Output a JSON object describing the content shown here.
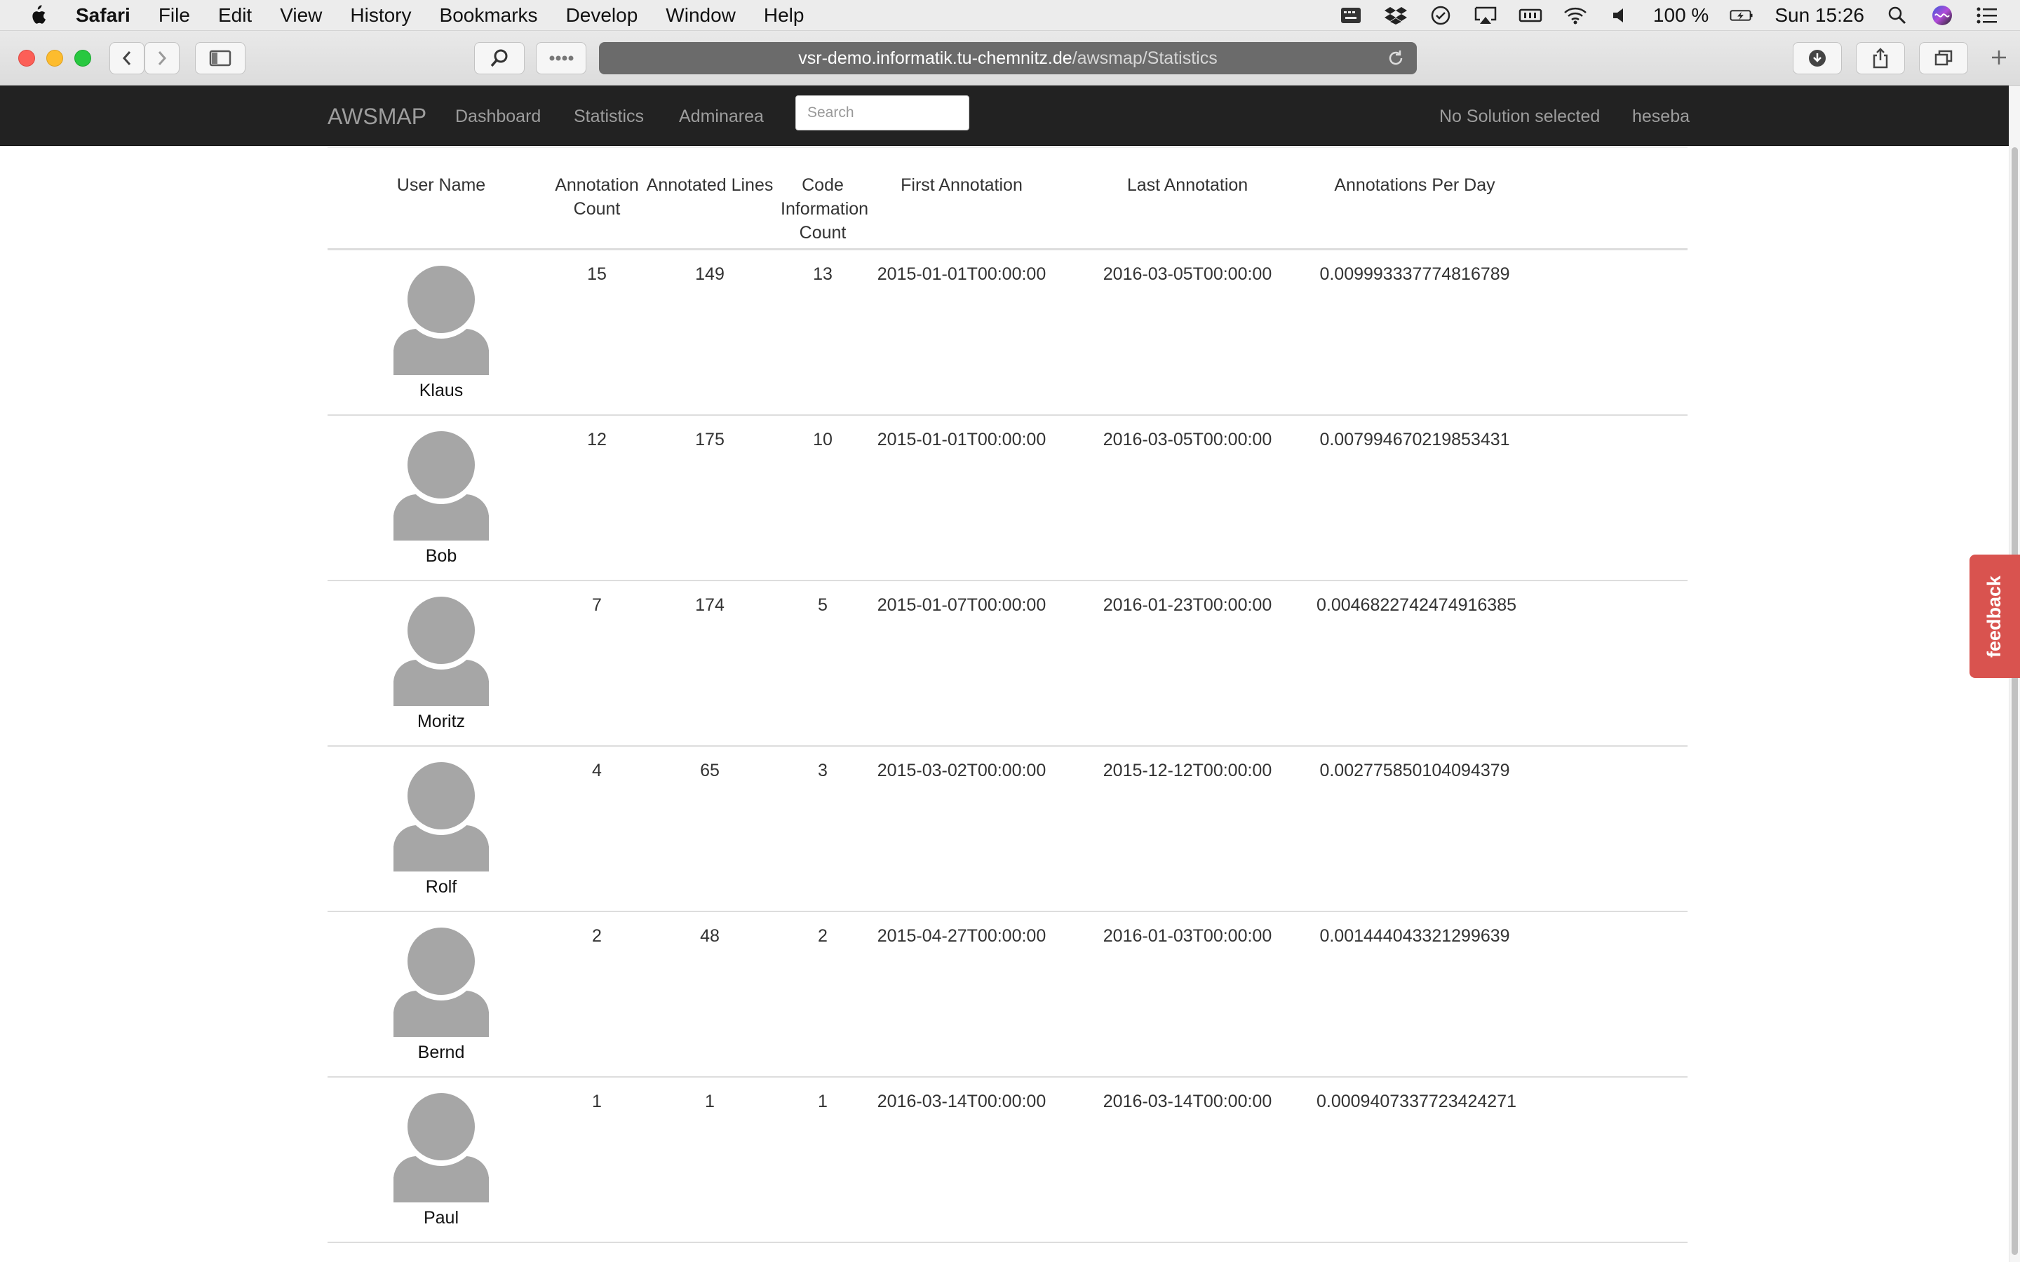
{
  "menubar": {
    "app_name": "Safari",
    "items": [
      "File",
      "Edit",
      "View",
      "History",
      "Bookmarks",
      "Develop",
      "Window",
      "Help"
    ],
    "battery": "100 %",
    "clock": "Sun 15:26"
  },
  "browser": {
    "url_host": "vsr-demo.informatik.tu-chemnitz.de",
    "url_path": "/awsmap/Statistics"
  },
  "navbar": {
    "brand": "AWSMAP",
    "links": [
      "Dashboard",
      "Statistics",
      "Adminarea"
    ],
    "search_placeholder": "Search",
    "solution_status": "No Solution selected",
    "username": "heseba"
  },
  "table": {
    "headers": {
      "user_name": "User Name",
      "annotation_count": "Annotation Count",
      "annotated_lines": "Annotated Lines",
      "code_information_count": "Code Information Count",
      "first_annotation": "First Annotation",
      "last_annotation": "Last Annotation",
      "annotations_per_day": "Annotations Per Day"
    },
    "rows": [
      {
        "name": "Klaus",
        "count": "15",
        "lines": "149",
        "code": "13",
        "first": "2015-01-01T00:00:00",
        "last": "2016-03-05T00:00:00",
        "per_day": "0.009993337774816789"
      },
      {
        "name": "Bob",
        "count": "12",
        "lines": "175",
        "code": "10",
        "first": "2015-01-01T00:00:00",
        "last": "2016-03-05T00:00:00",
        "per_day": "0.007994670219853431"
      },
      {
        "name": "Moritz",
        "count": "7",
        "lines": "174",
        "code": "5",
        "first": "2015-01-07T00:00:00",
        "last": "2016-01-23T00:00:00",
        "per_day": "0.0046822742474916385"
      },
      {
        "name": "Rolf",
        "count": "4",
        "lines": "65",
        "code": "3",
        "first": "2015-03-02T00:00:00",
        "last": "2015-12-12T00:00:00",
        "per_day": "0.002775850104094379"
      },
      {
        "name": "Bernd",
        "count": "2",
        "lines": "48",
        "code": "2",
        "first": "2015-04-27T00:00:00",
        "last": "2016-01-03T00:00:00",
        "per_day": "0.001444043321299639"
      },
      {
        "name": "Paul",
        "count": "1",
        "lines": "1",
        "code": "1",
        "first": "2016-03-14T00:00:00",
        "last": "2016-03-14T00:00:00",
        "per_day": "0.0009407337723424271"
      }
    ]
  },
  "feedback_label": "feedback"
}
